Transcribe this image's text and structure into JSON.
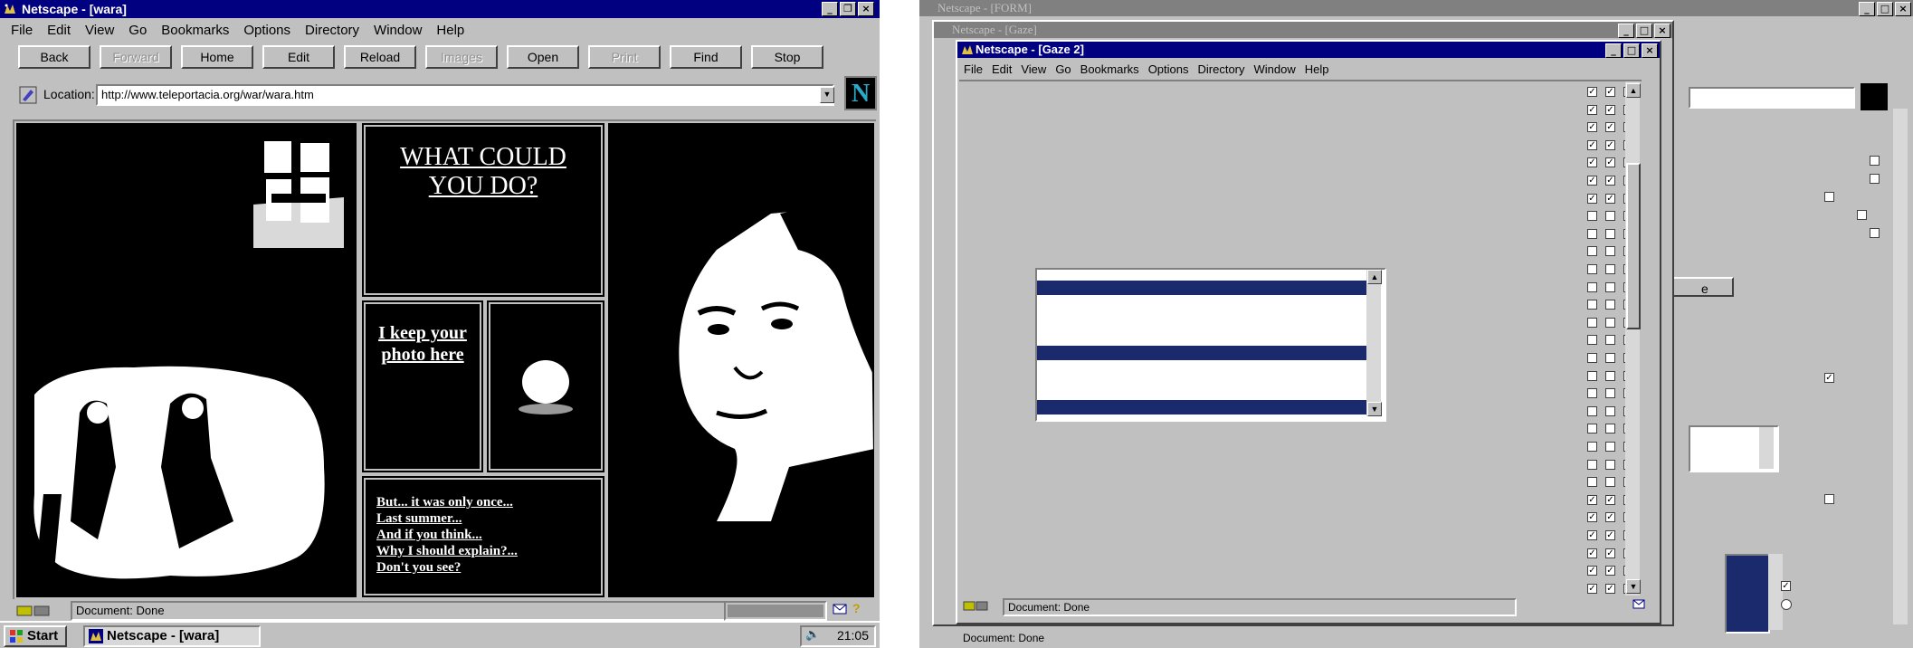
{
  "left_window": {
    "title": "Netscape - [wara]",
    "menu": [
      "File",
      "Edit",
      "View",
      "Go",
      "Bookmarks",
      "Options",
      "Directory",
      "Window",
      "Help"
    ],
    "toolbar": [
      {
        "label": "Back",
        "enabled": true
      },
      {
        "label": "Forward",
        "enabled": false
      },
      {
        "label": "Home",
        "enabled": true
      },
      {
        "label": "Edit",
        "enabled": true
      },
      {
        "label": "Reload",
        "enabled": true
      },
      {
        "label": "Images",
        "enabled": false
      },
      {
        "label": "Open",
        "enabled": true
      },
      {
        "label": "Print",
        "enabled": false
      },
      {
        "label": "Find",
        "enabled": true
      },
      {
        "label": "Stop",
        "enabled": true
      }
    ],
    "location_label": "Location:",
    "location_url": "http://www.teleportacia.org/war/wara.htm",
    "logo_letter": "N",
    "page": {
      "heading": "WHAT COULD YOU DO?",
      "photo_link": "I keep your photo here",
      "links": [
        "But... it was only once...",
        "Last summer...",
        "And if you think...",
        "Why I should explain?...",
        "Don't you see?"
      ]
    },
    "status_text": "Document: Done"
  },
  "taskbar": {
    "start_label": "Start",
    "task_label": "Netscape - [wara]",
    "clock": "21:05"
  },
  "right_screen": {
    "back_window_title": "Netscape - [FORM]",
    "mid_window_title": "Netscape - [Gaze]",
    "front_window_title": "Netscape - [Gaze 2]",
    "menu": [
      "File",
      "Edit",
      "View",
      "Go",
      "Bookmarks",
      "Options",
      "Directory",
      "Window",
      "Help"
    ],
    "status_text": "Document: Done",
    "bottom_status_text": "Document: Done",
    "back_button_fragment": "e",
    "checkbox_rows": [
      [
        1,
        1,
        1,
        1
      ],
      [
        1,
        1,
        1,
        1
      ],
      [
        1,
        1,
        1,
        1
      ],
      [
        1,
        1,
        1,
        1
      ],
      [
        1,
        1,
        1,
        1
      ],
      [
        1,
        1,
        1,
        1
      ],
      [
        1,
        1,
        1,
        0
      ],
      [
        0,
        0,
        0,
        0
      ],
      [
        0,
        0,
        0,
        0
      ],
      [
        0,
        0,
        0,
        0
      ],
      [
        0,
        0,
        0,
        0
      ],
      [
        0,
        0,
        0,
        0
      ],
      [
        0,
        0,
        0,
        0
      ],
      [
        0,
        0,
        0,
        0
      ],
      [
        0,
        0,
        0,
        0
      ],
      [
        0,
        0,
        0,
        0
      ],
      [
        0,
        0,
        0,
        0
      ],
      [
        0,
        0,
        0,
        0
      ],
      [
        0,
        0,
        0,
        0
      ],
      [
        0,
        0,
        0,
        0
      ],
      [
        0,
        0,
        0,
        0
      ],
      [
        0,
        0,
        0,
        0
      ],
      [
        0,
        0,
        0,
        1
      ],
      [
        1,
        1,
        1,
        1
      ],
      [
        1,
        1,
        1,
        1
      ],
      [
        1,
        1,
        1,
        1
      ],
      [
        1,
        1,
        1,
        1
      ],
      [
        1,
        1,
        1,
        1
      ],
      [
        1,
        1,
        1,
        1
      ]
    ]
  },
  "colors": {
    "title_active": "#000080",
    "title_inactive": "#808080",
    "face": "#c0c0c0",
    "stripe": "#1a2a6c"
  }
}
